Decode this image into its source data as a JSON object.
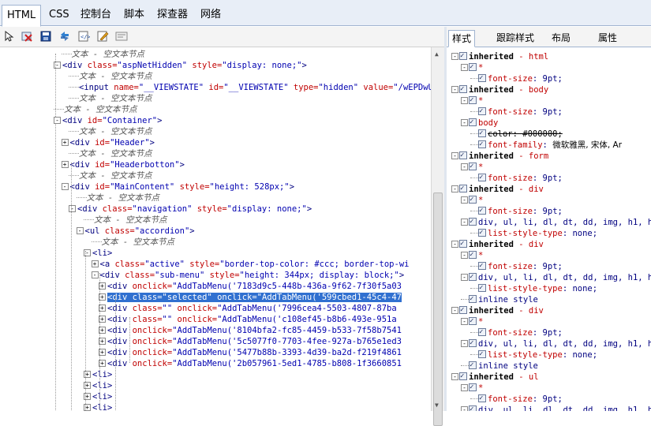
{
  "main_tabs": [
    "HTML",
    "CSS",
    "控制台",
    "脚本",
    "探查器",
    "网络"
  ],
  "right_tabs": [
    "样式",
    "跟踪样式",
    "布局",
    "属性"
  ],
  "toolbar_icons": [
    "select-element-icon",
    "clear-icon",
    "save-icon",
    "refresh-icon",
    "source-icon",
    "edit-icon",
    "outline-icon"
  ],
  "dom_rows": [
    {
      "indent": 5,
      "exp": "",
      "parts": [
        [
          "txt",
          "文本 - 空文本节点"
        ]
      ]
    },
    {
      "indent": 4,
      "exp": "-",
      "parts": [
        [
          "tag",
          "<div "
        ],
        [
          "attr",
          "class="
        ],
        [
          "val",
          "\"aspNetHidden\""
        ],
        [
          "attr",
          " style="
        ],
        [
          "val",
          "\"display: none;\""
        ],
        [
          "tag",
          ">"
        ]
      ]
    },
    {
      "indent": 6,
      "exp": "",
      "parts": [
        [
          "txt",
          "文本 - 空文本节点"
        ]
      ]
    },
    {
      "indent": 6,
      "exp": "",
      "parts": [
        [
          "tag",
          "<input "
        ],
        [
          "attr",
          "name="
        ],
        [
          "val",
          "\"__VIEWSTATE\""
        ],
        [
          "attr",
          " id="
        ],
        [
          "val",
          "\"__VIEWSTATE\""
        ],
        [
          "attr",
          " type="
        ],
        [
          "val",
          "\"hidden\""
        ],
        [
          "attr",
          " value="
        ],
        [
          "val",
          "\"/wEPDwUKMTI"
        ]
      ]
    },
    {
      "indent": 6,
      "exp": "",
      "parts": [
        [
          "txt",
          "文本 - 空文本节点"
        ]
      ]
    },
    {
      "indent": 4,
      "exp": "",
      "parts": [
        [
          "txt",
          "文本 - 空文本节点"
        ]
      ]
    },
    {
      "indent": 4,
      "exp": "-",
      "parts": [
        [
          "tag",
          "<div "
        ],
        [
          "attr",
          "id="
        ],
        [
          "val",
          "\"Container\""
        ],
        [
          "tag",
          ">"
        ]
      ]
    },
    {
      "indent": 6,
      "exp": "",
      "parts": [
        [
          "txt",
          "文本 - 空文本节点"
        ]
      ]
    },
    {
      "indent": 5,
      "exp": "+",
      "parts": [
        [
          "tag",
          "<div "
        ],
        [
          "attr",
          "id="
        ],
        [
          "val",
          "\"Header\""
        ],
        [
          "tag",
          ">"
        ]
      ]
    },
    {
      "indent": 6,
      "exp": "",
      "parts": [
        [
          "txt",
          "文本 - 空文本节点"
        ]
      ]
    },
    {
      "indent": 5,
      "exp": "+",
      "parts": [
        [
          "tag",
          "<div "
        ],
        [
          "attr",
          "id="
        ],
        [
          "val",
          "\"Headerbotton\""
        ],
        [
          "tag",
          ">"
        ]
      ]
    },
    {
      "indent": 6,
      "exp": "",
      "parts": [
        [
          "txt",
          "文本 - 空文本节点"
        ]
      ]
    },
    {
      "indent": 5,
      "exp": "-",
      "parts": [
        [
          "tag",
          "<div "
        ],
        [
          "attr",
          "id="
        ],
        [
          "val",
          "\"MainContent\""
        ],
        [
          "attr",
          " style="
        ],
        [
          "val",
          "\"height: 528px;\""
        ],
        [
          "tag",
          ">"
        ]
      ]
    },
    {
      "indent": 7,
      "exp": "",
      "parts": [
        [
          "txt",
          "文本 - 空文本节点"
        ]
      ]
    },
    {
      "indent": 6,
      "exp": "-",
      "parts": [
        [
          "tag",
          "<div "
        ],
        [
          "attr",
          "class="
        ],
        [
          "val",
          "\"navigation\""
        ],
        [
          "attr",
          " style="
        ],
        [
          "val",
          "\"display: none;\""
        ],
        [
          "tag",
          ">"
        ]
      ]
    },
    {
      "indent": 8,
      "exp": "",
      "parts": [
        [
          "txt",
          "文本 - 空文本节点"
        ]
      ]
    },
    {
      "indent": 7,
      "exp": "-",
      "parts": [
        [
          "tag",
          "<ul "
        ],
        [
          "attr",
          "class="
        ],
        [
          "val",
          "\"accordion\""
        ],
        [
          "tag",
          ">"
        ]
      ]
    },
    {
      "indent": 9,
      "exp": "",
      "parts": [
        [
          "txt",
          "文本 - 空文本节点"
        ]
      ]
    },
    {
      "indent": 8,
      "exp": "-",
      "parts": [
        [
          "tag",
          "<li>"
        ]
      ]
    },
    {
      "indent": 9,
      "exp": "+",
      "parts": [
        [
          "tag",
          "<a "
        ],
        [
          "attr",
          "class="
        ],
        [
          "val",
          "\"active\""
        ],
        [
          "attr",
          " style="
        ],
        [
          "val",
          "\"border-top-color: #ccc; border-top-wi"
        ]
      ]
    },
    {
      "indent": 9,
      "exp": "-",
      "parts": [
        [
          "tag",
          "<div "
        ],
        [
          "attr",
          "class="
        ],
        [
          "val",
          "\"sub-menu\""
        ],
        [
          "attr",
          " style="
        ],
        [
          "val",
          "\"height: 344px; display: block;\""
        ],
        [
          "tag",
          ">"
        ]
      ]
    },
    {
      "indent": 10,
      "exp": "+",
      "parts": [
        [
          "tag",
          "<div "
        ],
        [
          "attr",
          "onclick="
        ],
        [
          "val",
          "\"AddTabMenu('7183d9c5-448b-436a-9f62-7f30f5a03"
        ]
      ]
    },
    {
      "indent": 10,
      "exp": "+",
      "sel": true,
      "parts": [
        [
          "tag",
          "<div "
        ],
        [
          "attr",
          "class="
        ],
        [
          "val",
          "\"selected\""
        ],
        [
          "attr",
          " onclick="
        ],
        [
          "val",
          "\"AddTabMenu('599cbed1-45c4-47"
        ]
      ]
    },
    {
      "indent": 10,
      "exp": "+",
      "parts": [
        [
          "tag",
          "<div "
        ],
        [
          "attr",
          "class="
        ],
        [
          "val",
          "\"\""
        ],
        [
          "attr",
          " onclick="
        ],
        [
          "val",
          "\"AddTabMenu('7996cea4-5503-4807-87ba"
        ]
      ]
    },
    {
      "indent": 10,
      "exp": "+",
      "parts": [
        [
          "tag",
          "<div "
        ],
        [
          "attr",
          "class="
        ],
        [
          "val",
          "\"\""
        ],
        [
          "attr",
          " onclick="
        ],
        [
          "val",
          "\"AddTabMenu('c108ef45-b8b6-493e-951a"
        ]
      ]
    },
    {
      "indent": 10,
      "exp": "+",
      "parts": [
        [
          "tag",
          "<div "
        ],
        [
          "attr",
          "onclick="
        ],
        [
          "val",
          "\"AddTabMenu('8104bfa2-fc85-4459-b533-7f58b7541"
        ]
      ]
    },
    {
      "indent": 10,
      "exp": "+",
      "parts": [
        [
          "tag",
          "<div "
        ],
        [
          "attr",
          "onclick="
        ],
        [
          "val",
          "\"AddTabMenu('5c5077f0-7703-4fee-927a-b765e1ed3"
        ]
      ]
    },
    {
      "indent": 10,
      "exp": "+",
      "parts": [
        [
          "tag",
          "<div "
        ],
        [
          "attr",
          "onclick="
        ],
        [
          "val",
          "\"AddTabMenu('5477b88b-3393-4d39-ba2d-f219f4861"
        ]
      ]
    },
    {
      "indent": 10,
      "exp": "+",
      "parts": [
        [
          "tag",
          "<div "
        ],
        [
          "attr",
          "onclick="
        ],
        [
          "val",
          "\"AddTabMenu('2b057961-5ed1-4785-b808-1f3660851"
        ]
      ]
    },
    {
      "indent": 8,
      "exp": "+",
      "parts": [
        [
          "tag",
          "<li>"
        ]
      ]
    },
    {
      "indent": 8,
      "exp": "+",
      "parts": [
        [
          "tag",
          "<li>"
        ]
      ]
    },
    {
      "indent": 8,
      "exp": "+",
      "parts": [
        [
          "tag",
          "<li>"
        ]
      ]
    },
    {
      "indent": 8,
      "exp": "+",
      "parts": [
        [
          "tag",
          "<li>"
        ]
      ]
    }
  ],
  "style_rows": [
    {
      "indent": 0,
      "exp": "-",
      "chk": true,
      "parts": [
        [
          "inh",
          "inherited"
        ],
        [
          "attr",
          " - html"
        ]
      ]
    },
    {
      "indent": 1,
      "exp": "-",
      "chk": true,
      "parts": [
        [
          "attr",
          "*"
        ]
      ]
    },
    {
      "indent": 2,
      "exp": "",
      "chk": true,
      "parts": [
        [
          "attr",
          "font-size"
        ],
        [
          "tag",
          ": 9pt;"
        ]
      ]
    },
    {
      "indent": 0,
      "exp": "-",
      "chk": true,
      "parts": [
        [
          "inh",
          "inherited"
        ],
        [
          "attr",
          " - body"
        ]
      ]
    },
    {
      "indent": 1,
      "exp": "-",
      "chk": true,
      "parts": [
        [
          "attr",
          "*"
        ]
      ]
    },
    {
      "indent": 2,
      "exp": "",
      "chk": true,
      "parts": [
        [
          "attr",
          "font-size"
        ],
        [
          "tag",
          ": 9pt;"
        ]
      ]
    },
    {
      "indent": 1,
      "exp": "-",
      "chk": true,
      "parts": [
        [
          "attr",
          "body"
        ]
      ]
    },
    {
      "indent": 2,
      "exp": "",
      "chk": true,
      "parts": [
        [
          "strike",
          "color: #000000;"
        ]
      ]
    },
    {
      "indent": 2,
      "exp": "",
      "chk": true,
      "parts": [
        [
          "attr",
          "font-family"
        ],
        [
          "tag",
          ": "
        ],
        [
          "cn",
          "微软雅黑, 宋体, Ar"
        ]
      ]
    },
    {
      "indent": 0,
      "exp": "-",
      "chk": true,
      "parts": [
        [
          "inh",
          "inherited"
        ],
        [
          "attr",
          " - form"
        ]
      ]
    },
    {
      "indent": 1,
      "exp": "-",
      "chk": true,
      "parts": [
        [
          "attr",
          "*"
        ]
      ]
    },
    {
      "indent": 2,
      "exp": "",
      "chk": true,
      "parts": [
        [
          "attr",
          "font-size"
        ],
        [
          "tag",
          ": 9pt;"
        ]
      ]
    },
    {
      "indent": 0,
      "exp": "-",
      "chk": true,
      "parts": [
        [
          "inh",
          "inherited"
        ],
        [
          "attr",
          " - div"
        ]
      ]
    },
    {
      "indent": 1,
      "exp": "-",
      "chk": true,
      "parts": [
        [
          "attr",
          "*"
        ]
      ]
    },
    {
      "indent": 2,
      "exp": "",
      "chk": true,
      "parts": [
        [
          "attr",
          "font-size"
        ],
        [
          "tag",
          ": 9pt;"
        ]
      ]
    },
    {
      "indent": 1,
      "exp": "-",
      "chk": true,
      "parts": [
        [
          "tag",
          "div, ul, li, dl, dt, dd, img, h1, h"
        ]
      ]
    },
    {
      "indent": 2,
      "exp": "",
      "chk": true,
      "parts": [
        [
          "attr",
          "list-style-type"
        ],
        [
          "tag",
          ": none;"
        ]
      ]
    },
    {
      "indent": 0,
      "exp": "-",
      "chk": true,
      "parts": [
        [
          "inh",
          "inherited"
        ],
        [
          "attr",
          " - div"
        ]
      ]
    },
    {
      "indent": 1,
      "exp": "-",
      "chk": true,
      "parts": [
        [
          "attr",
          "*"
        ]
      ]
    },
    {
      "indent": 2,
      "exp": "",
      "chk": true,
      "parts": [
        [
          "attr",
          "font-size"
        ],
        [
          "tag",
          ": 9pt;"
        ]
      ]
    },
    {
      "indent": 1,
      "exp": "-",
      "chk": true,
      "parts": [
        [
          "tag",
          "div, ul, li, dl, dt, dd, img, h1, h"
        ]
      ]
    },
    {
      "indent": 2,
      "exp": "",
      "chk": true,
      "parts": [
        [
          "attr",
          "list-style-type"
        ],
        [
          "tag",
          ": none;"
        ]
      ]
    },
    {
      "indent": 1,
      "exp": "",
      "chk": true,
      "parts": [
        [
          "tag",
          "inline style"
        ]
      ]
    },
    {
      "indent": 0,
      "exp": "-",
      "chk": true,
      "parts": [
        [
          "inh",
          "inherited"
        ],
        [
          "attr",
          " - div"
        ]
      ]
    },
    {
      "indent": 1,
      "exp": "-",
      "chk": true,
      "parts": [
        [
          "attr",
          "*"
        ]
      ]
    },
    {
      "indent": 2,
      "exp": "",
      "chk": true,
      "parts": [
        [
          "attr",
          "font-size"
        ],
        [
          "tag",
          ": 9pt;"
        ]
      ]
    },
    {
      "indent": 1,
      "exp": "-",
      "chk": true,
      "parts": [
        [
          "tag",
          "div, ul, li, dl, dt, dd, img, h1, h"
        ]
      ]
    },
    {
      "indent": 2,
      "exp": "",
      "chk": true,
      "parts": [
        [
          "attr",
          "list-style-type"
        ],
        [
          "tag",
          ": none;"
        ]
      ]
    },
    {
      "indent": 1,
      "exp": "",
      "chk": true,
      "parts": [
        [
          "tag",
          "inline style"
        ]
      ]
    },
    {
      "indent": 0,
      "exp": "-",
      "chk": true,
      "parts": [
        [
          "inh",
          "inherited"
        ],
        [
          "attr",
          " - ul"
        ]
      ]
    },
    {
      "indent": 1,
      "exp": "-",
      "chk": true,
      "parts": [
        [
          "attr",
          "*"
        ]
      ]
    },
    {
      "indent": 2,
      "exp": "",
      "chk": true,
      "parts": [
        [
          "attr",
          "font-size"
        ],
        [
          "tag",
          ": 9pt;"
        ]
      ]
    },
    {
      "indent": 1,
      "exp": "-",
      "chk": true,
      "parts": [
        [
          "tag",
          "div, ul, li, dl, dt, dd, img, h1, h"
        ]
      ]
    }
  ]
}
